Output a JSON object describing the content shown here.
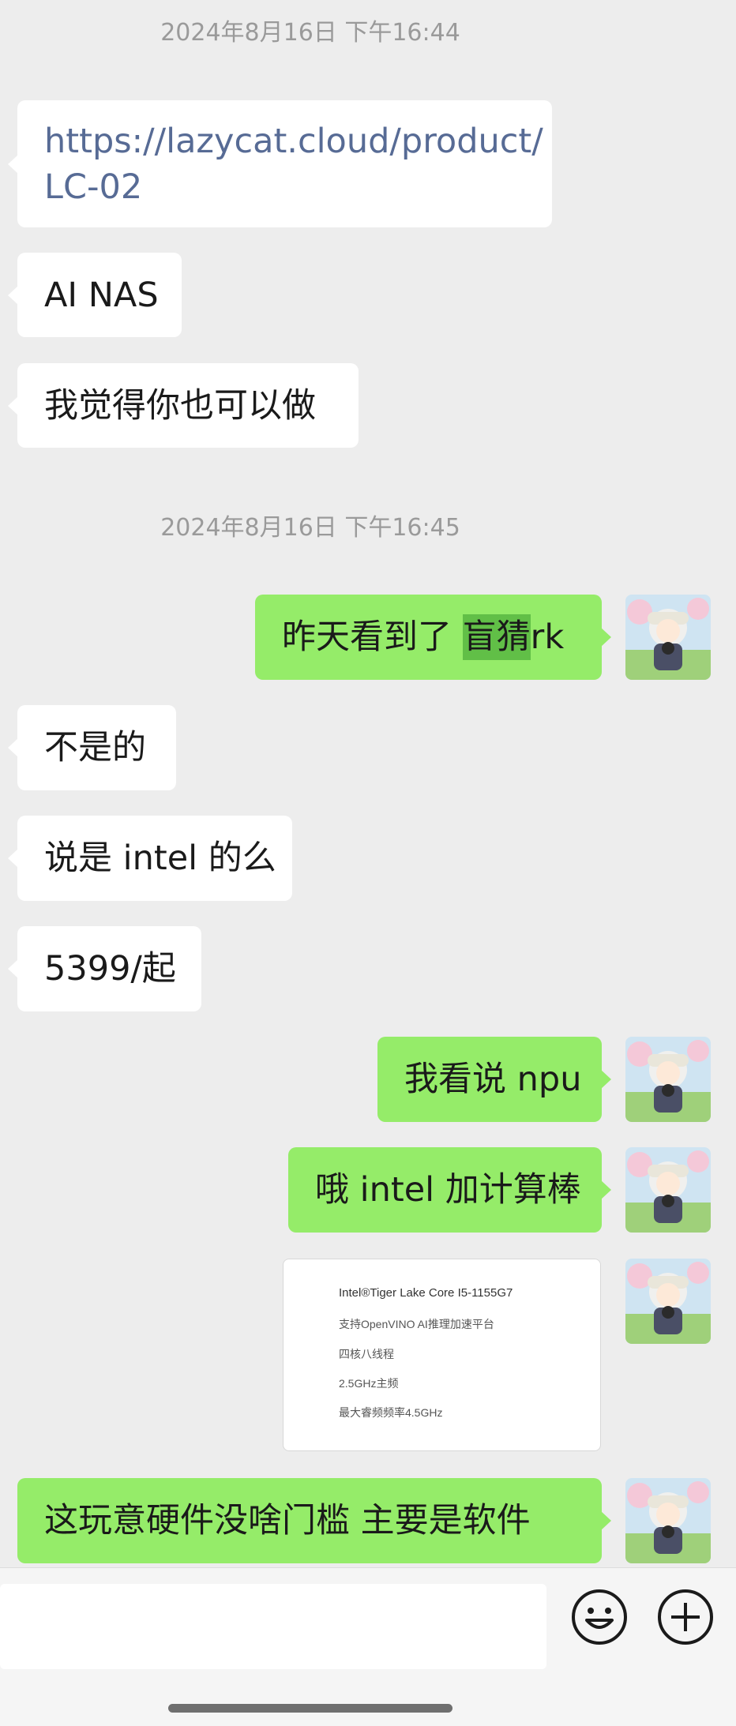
{
  "timestamps": [
    "2024年8月16日 下午16:44",
    "2024年8月16日 下午16:45"
  ],
  "messages": {
    "m1_line1": "https://lazycat.cloud/product/",
    "m1_line2": "LC-02",
    "m2": "AI NAS",
    "m3": "我觉得你也可以做",
    "m4_pre": "昨天看到了 ",
    "m4_hl": "盲猜",
    "m4_post": "rk",
    "m5": "不是的",
    "m6": "说是 intel 的么",
    "m7": "5399/起",
    "m8": "我看说 npu",
    "m9": "哦 intel 加计算棒",
    "m11": "这玩意硬件没啥门槛 主要是软件"
  },
  "image_card": {
    "lines": [
      "Intel®Tiger Lake Core I5-1155G7",
      "支持OpenVINO AI推理加速平台",
      "四核八线程",
      "2.5GHz主频",
      "最大睿频频率4.5GHz"
    ]
  },
  "input_bar": {
    "emoji_icon": "emoji-icon",
    "plus_icon": "plus-icon"
  },
  "colors": {
    "background": "#ededed",
    "sent_bubble": "#95ec69",
    "received_bubble": "#ffffff",
    "link": "#576b95",
    "highlight": "#61bf47"
  }
}
